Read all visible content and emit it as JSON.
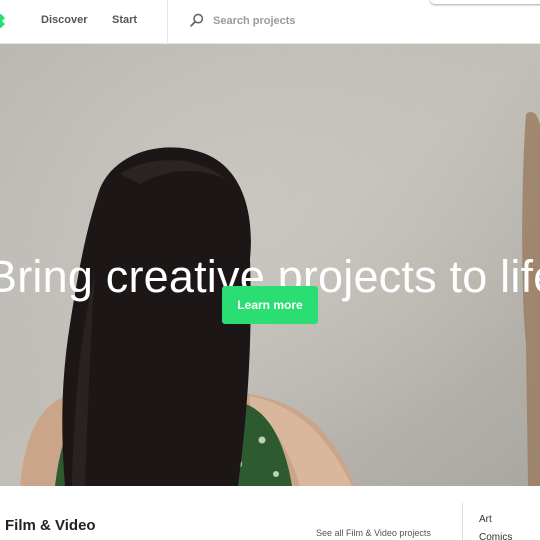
{
  "header": {
    "nav": {
      "discover": "Discover",
      "start": "Start"
    },
    "search": {
      "placeholder": "Search projects"
    },
    "icons": {
      "logo": "kickstarter-logo-fragment",
      "search": "search-icon"
    },
    "accent_color": "#2bde73"
  },
  "hero": {
    "headline": "Bring creative projects to life",
    "button_label": "Learn more",
    "button_color": "#2bde73"
  },
  "section": {
    "title": "Film & Video",
    "see_all": "See all Film & Video projects",
    "categories": [
      "Art",
      "Comics"
    ]
  }
}
